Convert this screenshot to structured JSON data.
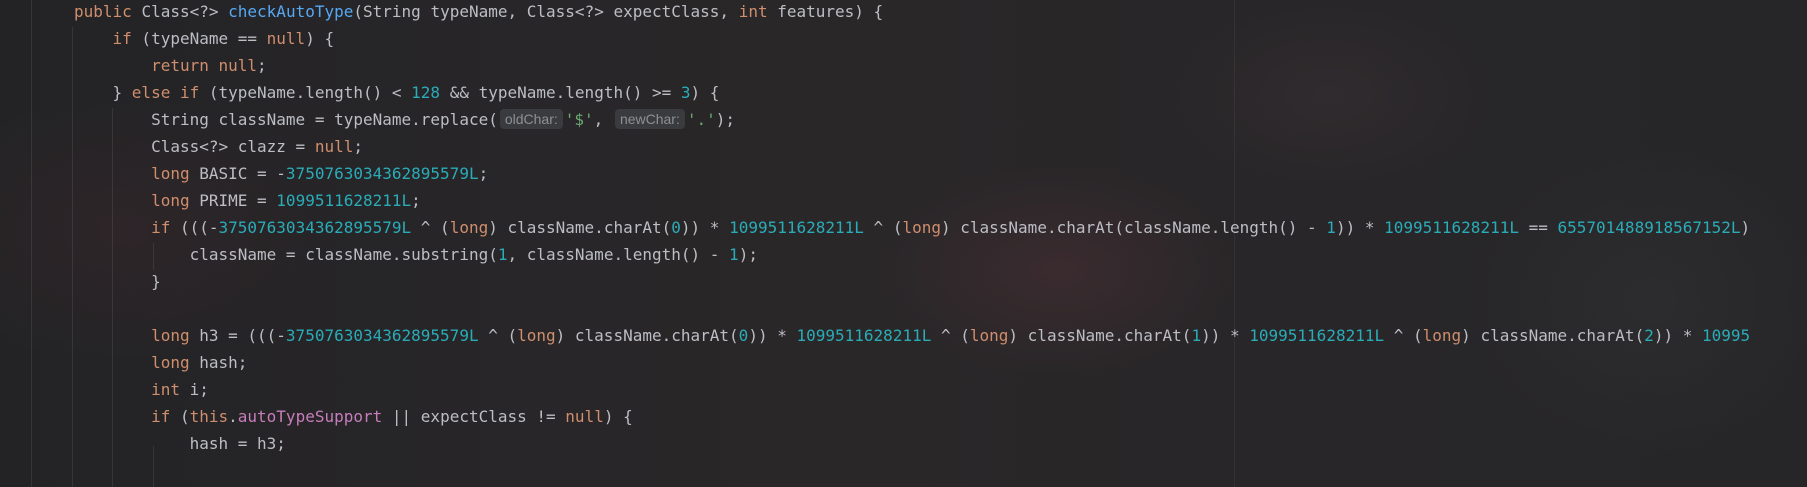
{
  "lines": [
    [
      {
        "t": "public ",
        "c": "kw"
      },
      {
        "t": "Class<?> "
      },
      {
        "t": "checkAutoType",
        "c": "fn"
      },
      {
        "t": "(String typeName, Class<?> expectClass, "
      },
      {
        "t": "int",
        "c": "kw"
      },
      {
        "t": " features) {"
      }
    ],
    [
      {
        "t": "    "
      },
      {
        "t": "if",
        "c": "kw"
      },
      {
        "t": " (typeName == "
      },
      {
        "t": "null",
        "c": "kw"
      },
      {
        "t": ") {"
      }
    ],
    [
      {
        "t": "        "
      },
      {
        "t": "return null",
        "c": "kw"
      },
      {
        "t": ";"
      }
    ],
    [
      {
        "t": "    } "
      },
      {
        "t": "else if",
        "c": "kw"
      },
      {
        "t": " (typeName.length() < "
      },
      {
        "t": "128",
        "c": "num"
      },
      {
        "t": " && typeName.length() >= "
      },
      {
        "t": "3",
        "c": "num"
      },
      {
        "t": ") {"
      }
    ],
    [
      {
        "t": "        String className = typeName.replace("
      },
      {
        "t": "oldChar:",
        "c": "hint"
      },
      {
        "t": "'$'",
        "c": "str"
      },
      {
        "t": ", "
      },
      {
        "t": "newChar:",
        "c": "hint"
      },
      {
        "t": "'.'",
        "c": "str"
      },
      {
        "t": ");"
      }
    ],
    [
      {
        "t": "        Class<?> clazz = "
      },
      {
        "t": "null",
        "c": "kw"
      },
      {
        "t": ";"
      }
    ],
    [
      {
        "t": "        "
      },
      {
        "t": "long",
        "c": "kw"
      },
      {
        "t": " BASIC = -"
      },
      {
        "t": "3750763034362895579L",
        "c": "num"
      },
      {
        "t": ";"
      }
    ],
    [
      {
        "t": "        "
      },
      {
        "t": "long",
        "c": "kw"
      },
      {
        "t": " PRIME = "
      },
      {
        "t": "1099511628211L",
        "c": "num"
      },
      {
        "t": ";"
      }
    ],
    [
      {
        "t": "        "
      },
      {
        "t": "if",
        "c": "kw"
      },
      {
        "t": " (((-"
      },
      {
        "t": "3750763034362895579L",
        "c": "num"
      },
      {
        "t": " ^ ("
      },
      {
        "t": "long",
        "c": "kw"
      },
      {
        "t": ") className.charAt("
      },
      {
        "t": "0",
        "c": "num"
      },
      {
        "t": ")) * "
      },
      {
        "t": "1099511628211L",
        "c": "num"
      },
      {
        "t": " ^ ("
      },
      {
        "t": "long",
        "c": "kw"
      },
      {
        "t": ") className.charAt(className.length() - "
      },
      {
        "t": "1",
        "c": "num"
      },
      {
        "t": ")) * "
      },
      {
        "t": "1099511628211L",
        "c": "num"
      },
      {
        "t": " == "
      },
      {
        "t": "655701488918567152L",
        "c": "num"
      },
      {
        "t": ")"
      }
    ],
    [
      {
        "t": "            className = className.substring("
      },
      {
        "t": "1",
        "c": "num"
      },
      {
        "t": ", className.length() - "
      },
      {
        "t": "1",
        "c": "num"
      },
      {
        "t": ");"
      }
    ],
    [
      {
        "t": "        }"
      }
    ],
    [],
    [
      {
        "t": "        "
      },
      {
        "t": "long",
        "c": "kw"
      },
      {
        "t": " h3 = (((-"
      },
      {
        "t": "3750763034362895579L",
        "c": "num"
      },
      {
        "t": " ^ ("
      },
      {
        "t": "long",
        "c": "kw"
      },
      {
        "t": ") className.charAt("
      },
      {
        "t": "0",
        "c": "num"
      },
      {
        "t": ")) * "
      },
      {
        "t": "1099511628211L",
        "c": "num"
      },
      {
        "t": " ^ ("
      },
      {
        "t": "long",
        "c": "kw"
      },
      {
        "t": ") className.charAt("
      },
      {
        "t": "1",
        "c": "num"
      },
      {
        "t": ")) * "
      },
      {
        "t": "1099511628211L",
        "c": "num"
      },
      {
        "t": " ^ ("
      },
      {
        "t": "long",
        "c": "kw"
      },
      {
        "t": ") className.charAt("
      },
      {
        "t": "2",
        "c": "num"
      },
      {
        "t": ")) * "
      },
      {
        "t": "10995",
        "c": "num"
      }
    ],
    [
      {
        "t": "        "
      },
      {
        "t": "long",
        "c": "kw"
      },
      {
        "t": " hash;"
      }
    ],
    [
      {
        "t": "        "
      },
      {
        "t": "int",
        "c": "kw"
      },
      {
        "t": " i;"
      }
    ],
    [
      {
        "t": "        "
      },
      {
        "t": "if",
        "c": "kw"
      },
      {
        "t": " ("
      },
      {
        "t": "this",
        "c": "kw"
      },
      {
        "t": "."
      },
      {
        "t": "autoTypeSupport",
        "c": "field"
      },
      {
        "t": " || expectClass != "
      },
      {
        "t": "null",
        "c": "kw"
      },
      {
        "t": ") {"
      }
    ],
    [
      {
        "t": "            hash = h3;"
      }
    ]
  ]
}
